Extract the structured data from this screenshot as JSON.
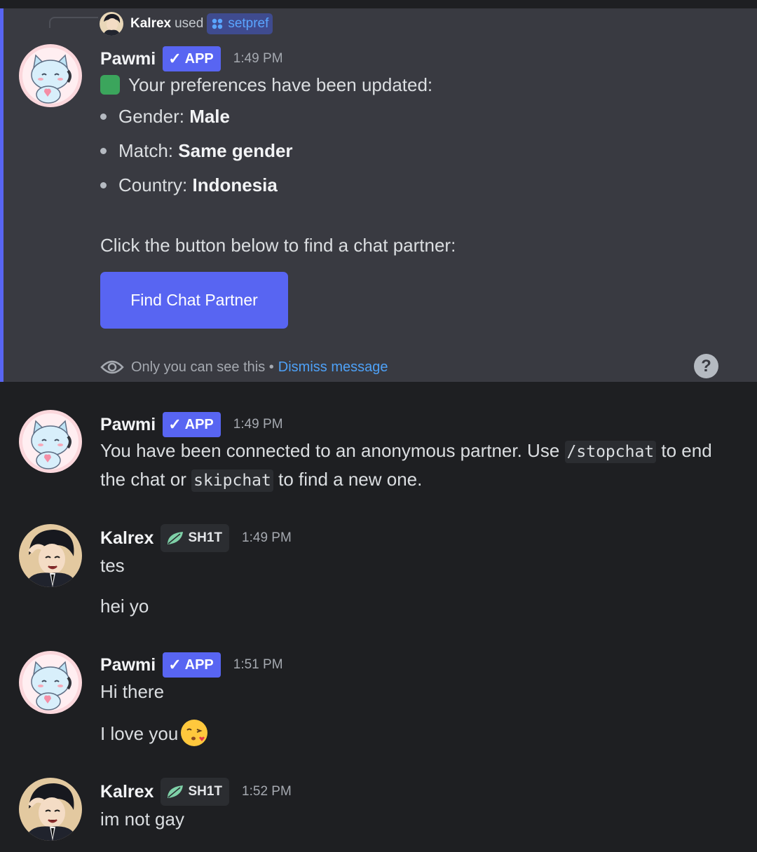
{
  "interaction": {
    "user": "Kalrex",
    "used_label": "used",
    "command": "setpref"
  },
  "ephemeral_message": {
    "author": "Pawmi",
    "badge": "APP",
    "time": "1:49 PM",
    "heading": "Your preferences have been updated:",
    "prefs": [
      {
        "label": "Gender:",
        "value": "Male"
      },
      {
        "label": "Match:",
        "value": "Same gender"
      },
      {
        "label": "Country:",
        "value": "Indonesia"
      }
    ],
    "prompt": "Click the button below to find a chat partner:",
    "button_label": "Find Chat Partner",
    "only_you": "Only you can see this",
    "separator": "•",
    "dismiss": "Dismiss message"
  },
  "messages": [
    {
      "author": "Pawmi",
      "badge": "APP",
      "time": "1:49 PM",
      "line1_pre": "You have been connected to an anonymous partner. Use",
      "code1": "/stopchat",
      "line1_post": "to end",
      "line2_pre": "the chat or",
      "code2": "skipchat",
      "line2_post": "to find a new one."
    },
    {
      "author": "Kalrex",
      "role": "SH1T",
      "time": "1:49 PM",
      "lines": [
        "tes",
        "hei yo"
      ]
    },
    {
      "author": "Pawmi",
      "badge": "APP",
      "time": "1:51 PM",
      "lines": [
        "Hi there",
        "I love you"
      ]
    },
    {
      "author": "Kalrex",
      "role": "SH1T",
      "time": "1:52 PM",
      "lines": [
        "im not gay"
      ]
    }
  ],
  "colors": {
    "background": "#1e1f22",
    "ephemeral_bg": "#393a41",
    "accent": "#5865f2",
    "link": "#4ea1f7"
  },
  "icons": [
    "slash-command-icon",
    "eye-icon",
    "help-icon",
    "check-icon",
    "leaf-icon",
    "check-box-emoji",
    "kiss-emoji"
  ]
}
